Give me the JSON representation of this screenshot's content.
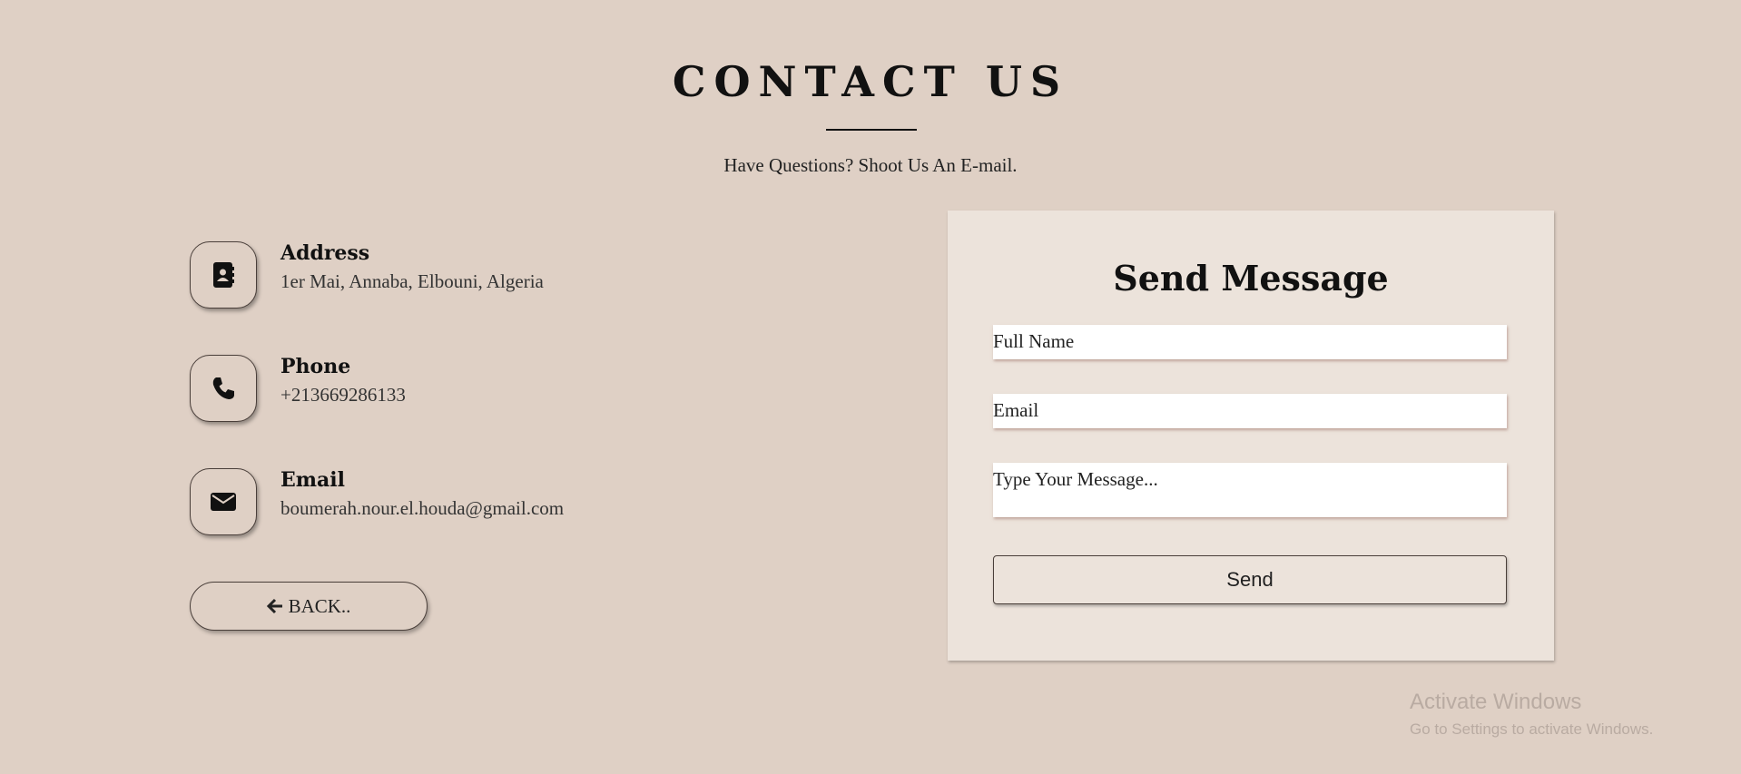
{
  "header": {
    "title": "CONTACT US",
    "subtitle": "Have Questions? Shoot Us An E-mail."
  },
  "contact_info": [
    {
      "icon": "address-book-icon",
      "label": "Address",
      "value": "1er Mai, Annaba, Elbouni, Algeria"
    },
    {
      "icon": "phone-icon",
      "label": "Phone",
      "value": "+213669286133"
    },
    {
      "icon": "envelope-icon",
      "label": "Email",
      "value": "boumerah.nour.el.houda@gmail.com"
    }
  ],
  "back_button": {
    "label": "BACK..",
    "icon": "arrow-left-icon"
  },
  "form": {
    "title": "Send Message",
    "full_name_placeholder": "Full Name",
    "email_placeholder": "Email",
    "message_placeholder": "Type Your Message...",
    "send_label": "Send"
  },
  "watermark": {
    "title": "Activate Windows",
    "subtitle": "Go to Settings to activate Windows."
  },
  "colors": {
    "background": "#dfd0c5",
    "panel": "#ece3db",
    "text": "#111111"
  }
}
